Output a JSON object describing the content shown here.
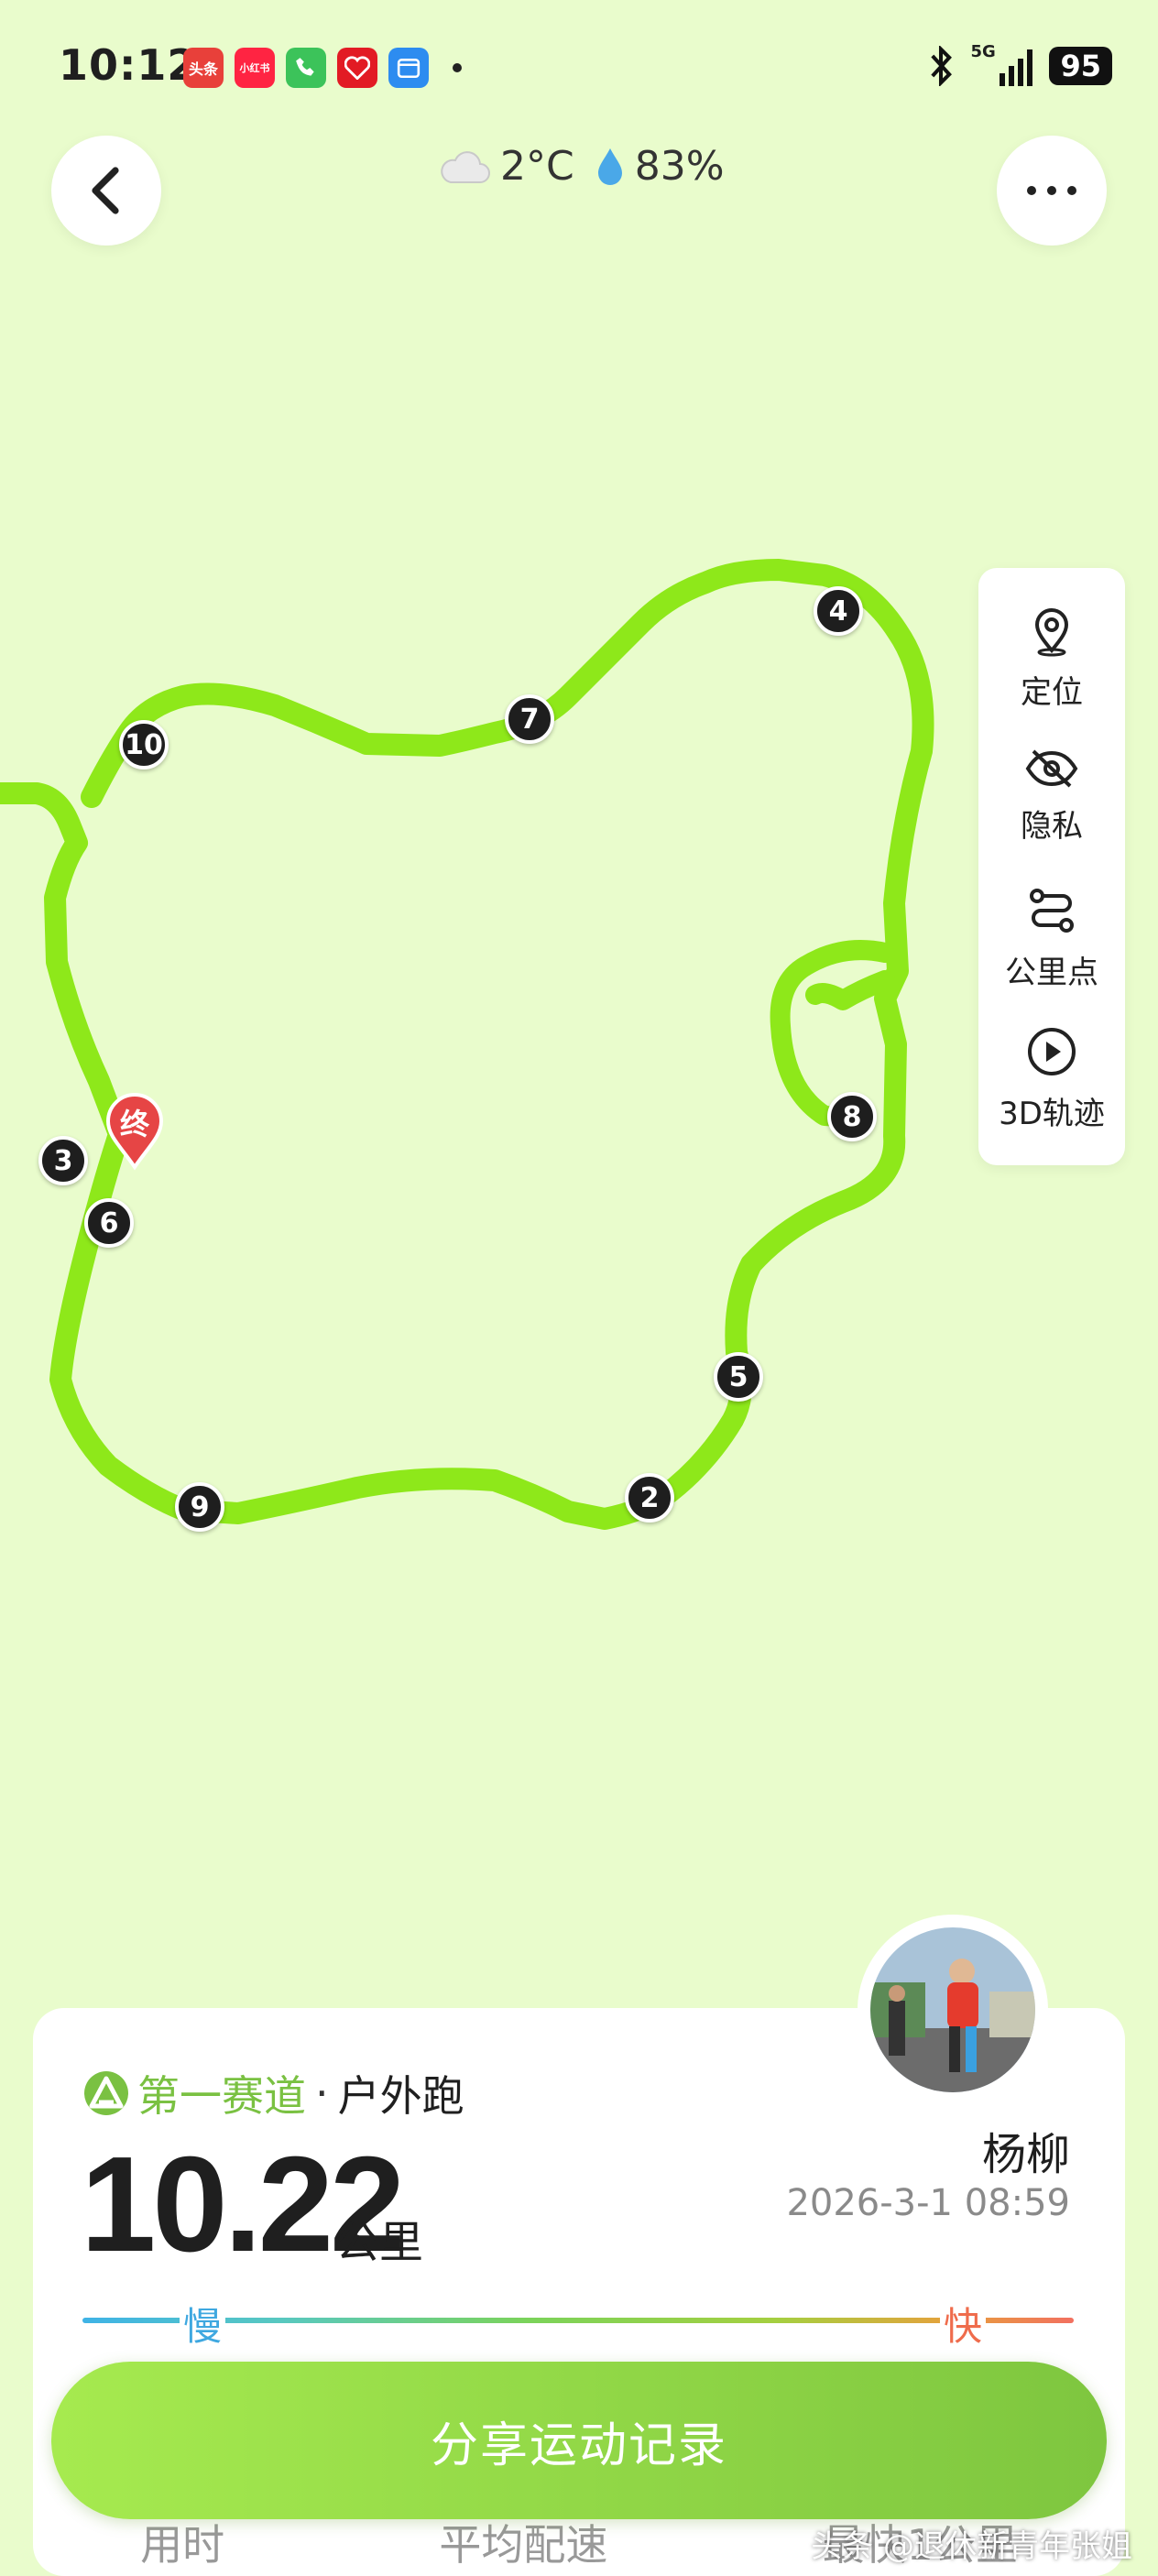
{
  "status_bar": {
    "time": "10:12",
    "network": "5G",
    "battery": "95",
    "notification_icons": [
      {
        "name": "toutiao-icon",
        "label": "头条",
        "color": "#e8403a"
      },
      {
        "name": "xiaohongshu-icon",
        "label": "小红书",
        "color": "#ff2442"
      },
      {
        "name": "phone-icon",
        "label": "",
        "color": "#3cc35a"
      },
      {
        "name": "health-icon",
        "label": "",
        "color": "#e21b24"
      },
      {
        "name": "calendar-icon",
        "label": "",
        "color": "#2d8cf0"
      }
    ]
  },
  "header": {
    "temperature": "2°C",
    "humidity": "83%"
  },
  "map": {
    "route_color": "#8ee81a",
    "end_marker_label": "终",
    "km_markers": [
      "2",
      "3",
      "4",
      "5",
      "6",
      "7",
      "8",
      "9",
      "10"
    ]
  },
  "side_panel": {
    "items": [
      {
        "label": "定位",
        "icon": "location-pin-icon"
      },
      {
        "label": "隐私",
        "icon": "eye-slash-icon"
      },
      {
        "label": "公里点",
        "icon": "route-points-icon"
      },
      {
        "label": "3D轨迹",
        "icon": "play-circle-icon"
      }
    ]
  },
  "summary": {
    "brand": "第一赛道",
    "activity_type": "户外跑",
    "distance": "10.22",
    "distance_unit": "公里",
    "user_name": "杨柳",
    "date": "2026-3-1 08:59",
    "pace_slow_label": "慢",
    "pace_fast_label": "快",
    "stat_labels": [
      "用时",
      "平均配速",
      "最快1公里"
    ]
  },
  "share_button": "分享运动记录",
  "watermark": "头条 @退休新青年张姐",
  "colors": {
    "background": "#e9fccc",
    "accent": "#7ac142",
    "route": "#8ee81a"
  }
}
